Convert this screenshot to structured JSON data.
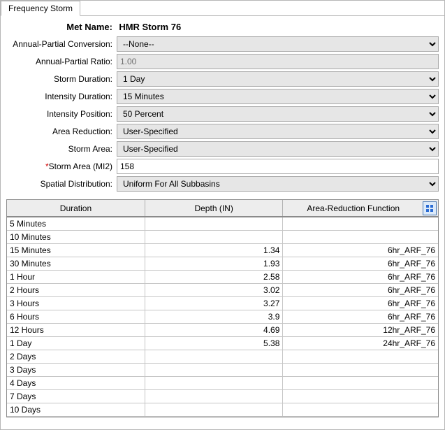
{
  "tab": {
    "label": "Frequency Storm"
  },
  "header": {
    "label": "Met Name:",
    "value": "HMR Storm 76"
  },
  "form": {
    "annual_partial_conversion": {
      "label": "Annual-Partial Conversion:",
      "value": "--None--"
    },
    "annual_partial_ratio": {
      "label": "Annual-Partial Ratio:",
      "value": "1.00"
    },
    "storm_duration": {
      "label": "Storm Duration:",
      "value": "1 Day"
    },
    "intensity_duration": {
      "label": "Intensity Duration:",
      "value": "15 Minutes"
    },
    "intensity_position": {
      "label": "Intensity Position:",
      "value": "50 Percent"
    },
    "area_reduction": {
      "label": "Area Reduction:",
      "value": "User-Specified"
    },
    "storm_area": {
      "label": "Storm Area:",
      "value": "User-Specified"
    },
    "storm_area_mi2": {
      "label": "Storm Area (MI2)",
      "value": "158",
      "required_mark": "*"
    },
    "spatial_distribution": {
      "label": "Spatial Distribution:",
      "value": "Uniform For All Subbasins"
    }
  },
  "table": {
    "headers": {
      "duration": "Duration",
      "depth": "Depth (IN)",
      "arf": "Area-Reduction Function"
    },
    "rows": [
      {
        "duration": "5 Minutes",
        "depth": "",
        "arf": ""
      },
      {
        "duration": "10 Minutes",
        "depth": "",
        "arf": ""
      },
      {
        "duration": "15 Minutes",
        "depth": "1.34",
        "arf": "6hr_ARF_76"
      },
      {
        "duration": "30 Minutes",
        "depth": "1.93",
        "arf": "6hr_ARF_76"
      },
      {
        "duration": "1 Hour",
        "depth": "2.58",
        "arf": "6hr_ARF_76"
      },
      {
        "duration": "2 Hours",
        "depth": "3.02",
        "arf": "6hr_ARF_76"
      },
      {
        "duration": "3 Hours",
        "depth": "3.27",
        "arf": "6hr_ARF_76"
      },
      {
        "duration": "6 Hours",
        "depth": "3.9",
        "arf": "6hr_ARF_76"
      },
      {
        "duration": "12 Hours",
        "depth": "4.69",
        "arf": "12hr_ARF_76"
      },
      {
        "duration": "1 Day",
        "depth": "5.38",
        "arf": "24hr_ARF_76"
      },
      {
        "duration": "2 Days",
        "depth": "",
        "arf": ""
      },
      {
        "duration": "3 Days",
        "depth": "",
        "arf": ""
      },
      {
        "duration": "4 Days",
        "depth": "",
        "arf": ""
      },
      {
        "duration": "7 Days",
        "depth": "",
        "arf": ""
      },
      {
        "duration": "10 Days",
        "depth": "",
        "arf": ""
      }
    ]
  }
}
